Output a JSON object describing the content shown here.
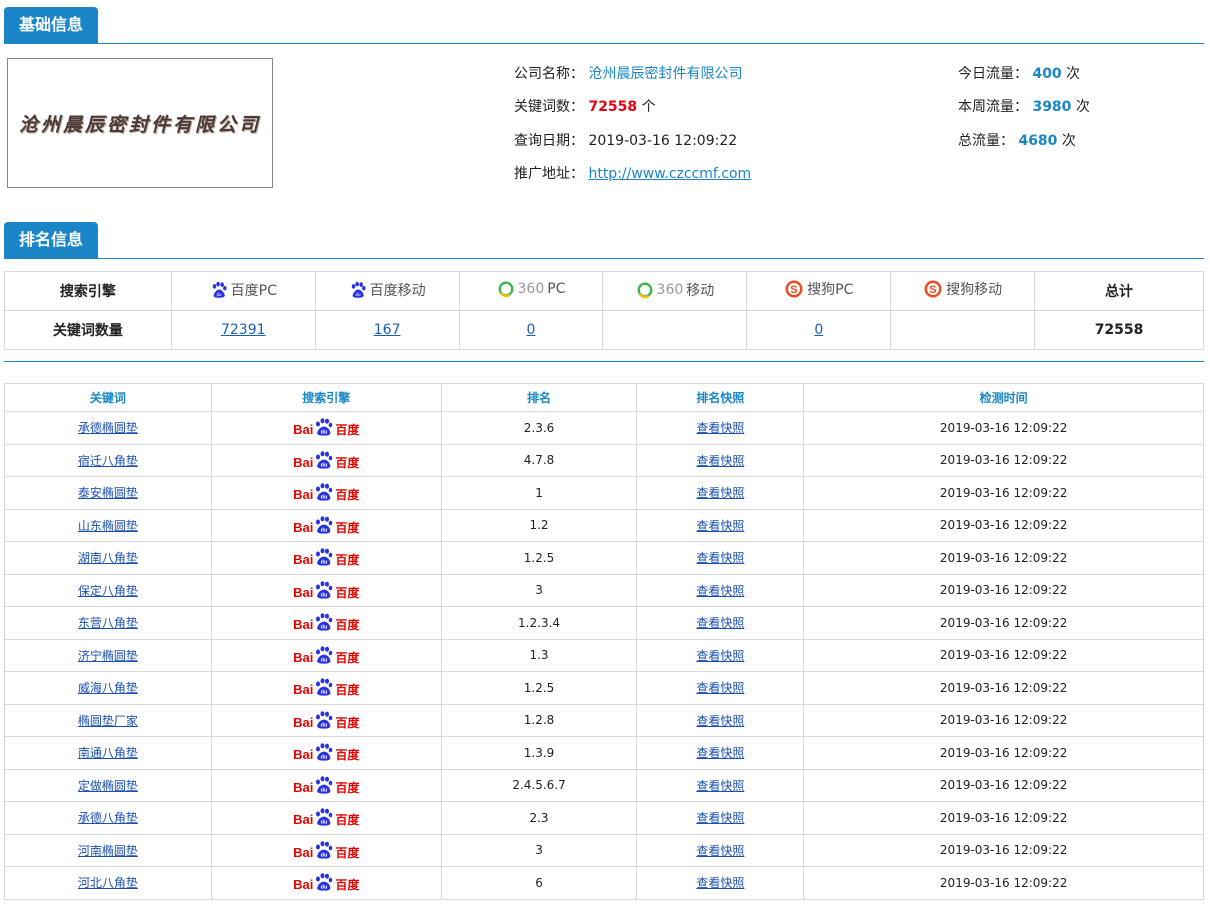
{
  "sections": {
    "basic_title": "基础信息",
    "rank_title": "排名信息"
  },
  "logo": {
    "text": "沧州晨辰密封件有限公司"
  },
  "company": {
    "name_label": "公司名称：",
    "name_value": "沧州晨辰密封件有限公司",
    "keywords_label": "关键词数：",
    "keywords_value": "72558",
    "keywords_unit": "个",
    "date_label": "查询日期：",
    "date_value": "2019-03-16 12:09:22",
    "url_label": "推广地址：",
    "url_value": "http://www.czccmf.com"
  },
  "traffic": {
    "today_label": "今日流量：",
    "today_value": "400",
    "today_unit": "次",
    "week_label": "本周流量：",
    "week_value": "3980",
    "week_unit": "次",
    "total_label": "总流量：",
    "total_value": "4680",
    "total_unit": "次"
  },
  "rank_table": {
    "row1_label": "搜索引擎",
    "row2_label": "关键词数量",
    "total_label": "总计",
    "total_value": "72558",
    "engines": [
      {
        "name": "百度PC",
        "icon": "baidu-paw-icon",
        "count": "72391"
      },
      {
        "name": "百度移动",
        "icon": "baidu-paw-icon",
        "count": "167"
      },
      {
        "name": "PC",
        "prefix": "360",
        "icon": "360-icon",
        "count": "0"
      },
      {
        "name": "移动",
        "prefix": "360",
        "icon": "360-icon",
        "count": ""
      },
      {
        "name": "搜狗PC",
        "icon": "sogou-icon",
        "count": "0"
      },
      {
        "name": "搜狗移动",
        "icon": "sogou-icon",
        "count": ""
      }
    ]
  },
  "kw_table": {
    "headers": [
      "关键词",
      "搜索引擎",
      "排名",
      "排名快照",
      "检测时间"
    ],
    "engine_logo": {
      "left": "Bai",
      "right": "百度"
    },
    "snapshot_label": "查看快照",
    "rows": [
      {
        "keyword": "承德椭圆垫",
        "rank": "2.3.6",
        "time": "2019-03-16 12:09:22"
      },
      {
        "keyword": "宿迁八角垫",
        "rank": "4.7.8",
        "time": "2019-03-16 12:09:22"
      },
      {
        "keyword": "泰安椭圆垫",
        "rank": "1",
        "time": "2019-03-16 12:09:22"
      },
      {
        "keyword": "山东椭圆垫",
        "rank": "1.2",
        "time": "2019-03-16 12:09:22"
      },
      {
        "keyword": "湖南八角垫",
        "rank": "1.2.5",
        "time": "2019-03-16 12:09:22"
      },
      {
        "keyword": "保定八角垫",
        "rank": "3",
        "time": "2019-03-16 12:09:22"
      },
      {
        "keyword": "东营八角垫",
        "rank": "1.2.3.4",
        "time": "2019-03-16 12:09:22"
      },
      {
        "keyword": "济宁椭圆垫",
        "rank": "1.3",
        "time": "2019-03-16 12:09:22"
      },
      {
        "keyword": "威海八角垫",
        "rank": "1.2.5",
        "time": "2019-03-16 12:09:22"
      },
      {
        "keyword": "椭圆垫厂家",
        "rank": "1.2.8",
        "time": "2019-03-16 12:09:22"
      },
      {
        "keyword": "南通八角垫",
        "rank": "1.3.9",
        "time": "2019-03-16 12:09:22"
      },
      {
        "keyword": "定做椭圆垫",
        "rank": "2.4.5.6.7",
        "time": "2019-03-16 12:09:22"
      },
      {
        "keyword": "承德八角垫",
        "rank": "2.3",
        "time": "2019-03-16 12:09:22"
      },
      {
        "keyword": "河南椭圆垫",
        "rank": "3",
        "time": "2019-03-16 12:09:22"
      },
      {
        "keyword": "河北八角垫",
        "rank": "6",
        "time": "2019-03-16 12:09:22"
      }
    ]
  },
  "colors": {
    "accent": "#1a86c8",
    "red": "#e60012",
    "baidu_red": "#e10601",
    "baidu_blue": "#2932e1"
  }
}
